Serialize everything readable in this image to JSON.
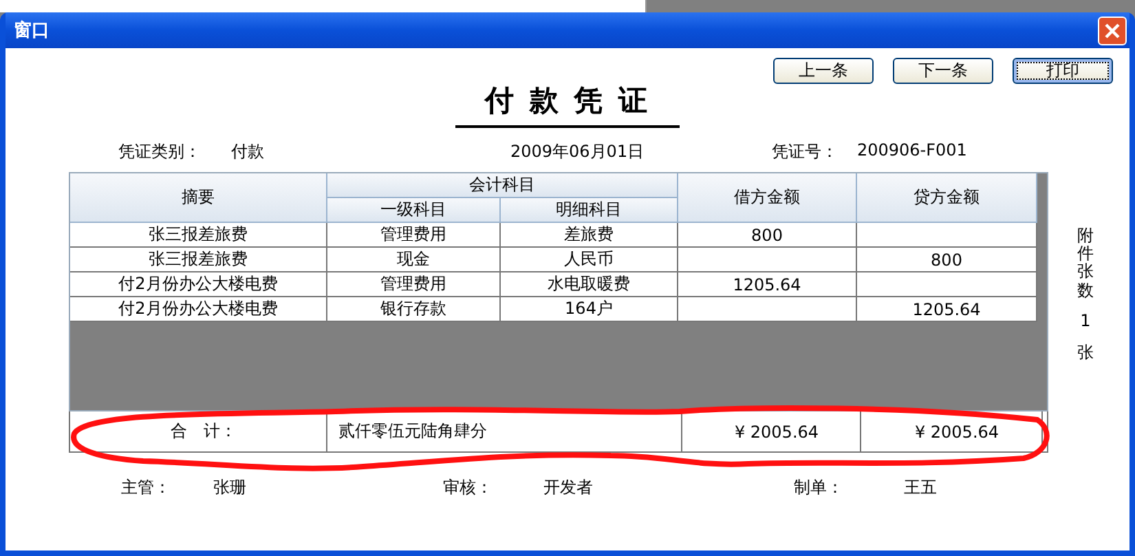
{
  "window": {
    "title": "窗口"
  },
  "buttons": [
    {
      "label": "上一条",
      "focused": false
    },
    {
      "label": "下一条",
      "focused": false
    },
    {
      "label": "打印",
      "focused": true
    }
  ],
  "voucher": {
    "title": "付 款 凭 证",
    "type_label": "凭证类别：",
    "type_value": "付款",
    "date": "2009年06月01日",
    "number_label": "凭证号：",
    "number_value": "200906-F001"
  },
  "table": {
    "columns": {
      "summary": "摘要",
      "account_group": "会计科目",
      "account_level1": "一级科目",
      "account_detail": "明细科目",
      "debit": "借方金额",
      "credit": "贷方金额"
    },
    "rows": [
      {
        "summary": "张三报差旅费",
        "account_level1": "管理费用",
        "account_detail": "差旅费",
        "debit": "800",
        "credit": ""
      },
      {
        "summary": "张三报差旅费",
        "account_level1": "现金",
        "account_detail": "人民币",
        "debit": "",
        "credit": "800"
      },
      {
        "summary": "付2月份办公大楼电费",
        "account_level1": "管理费用",
        "account_detail": "水电取暖费",
        "debit": "1205.64",
        "credit": ""
      },
      {
        "summary": "付2月份办公大楼电费",
        "account_level1": "银行存款",
        "account_detail": "164户",
        "debit": "",
        "credit": "1205.64"
      }
    ]
  },
  "attachments": {
    "label": "附件张数",
    "count": "1",
    "unit": "张"
  },
  "total": {
    "label": "合　计：",
    "amount_words": "贰仟零伍元陆角肆分",
    "debit": "¥ 2005.64",
    "credit": "¥ 2005.64"
  },
  "signatures": [
    {
      "label": "主管：",
      "name": "张珊"
    },
    {
      "label": "审核：",
      "name": "开发者"
    },
    {
      "label": "制单：",
      "name": "王五"
    }
  ]
}
